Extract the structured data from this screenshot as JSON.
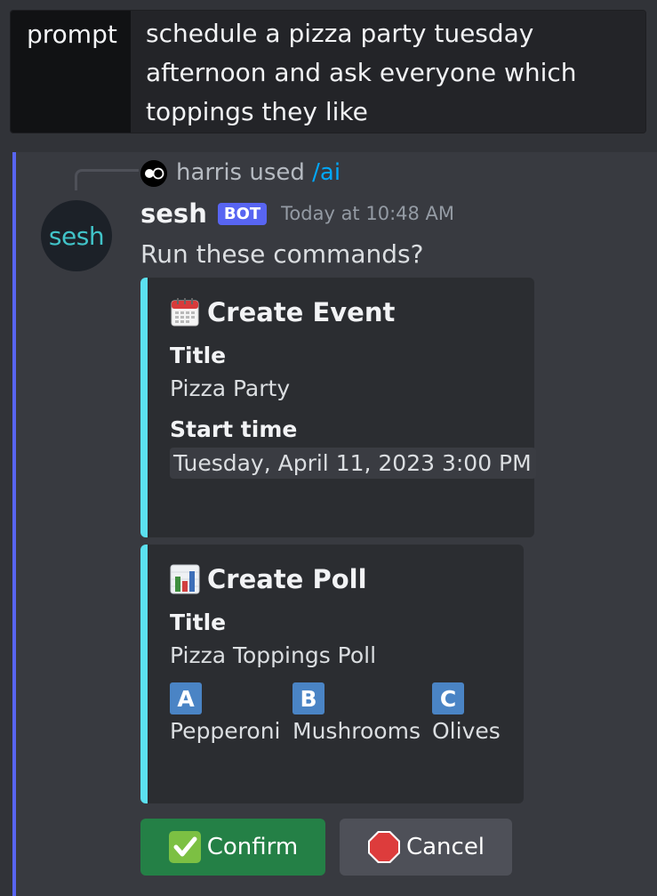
{
  "prompt": {
    "label": "prompt",
    "value": "schedule a pizza party tuesday afternoon and ask everyone which toppings they like"
  },
  "reply": {
    "user": "harris",
    "used_text": "used",
    "command": "/ai"
  },
  "message": {
    "avatar_text": "sesh",
    "author": "sesh",
    "badge": "BOT",
    "timestamp": "Today at 10:48 AM",
    "content": "Run these commands?"
  },
  "event_embed": {
    "icon": "calendar-icon",
    "title": "Create Event",
    "title_field_label": "Title",
    "title_field_value": "Pizza Party",
    "start_label": "Start time",
    "start_value": "Tuesday, April 11, 2023 3:00 PM",
    "accent_color": "#5be1f0"
  },
  "poll_embed": {
    "icon": "bar-chart-icon",
    "title": "Create Poll",
    "title_field_label": "Title",
    "title_field_value": "Pizza Toppings Poll",
    "options": [
      {
        "letter": "A",
        "label": "Pepperoni"
      },
      {
        "letter": "B",
        "label": "Mushrooms"
      },
      {
        "letter": "C",
        "label": "Olives"
      }
    ],
    "accent_color": "#5be1f0"
  },
  "actions": {
    "confirm_label": "Confirm",
    "confirm_icon": "check-mark-icon",
    "confirm_color": "#248046",
    "cancel_label": "Cancel",
    "cancel_icon": "stop-sign-icon",
    "cancel_color": "#4e5058"
  }
}
